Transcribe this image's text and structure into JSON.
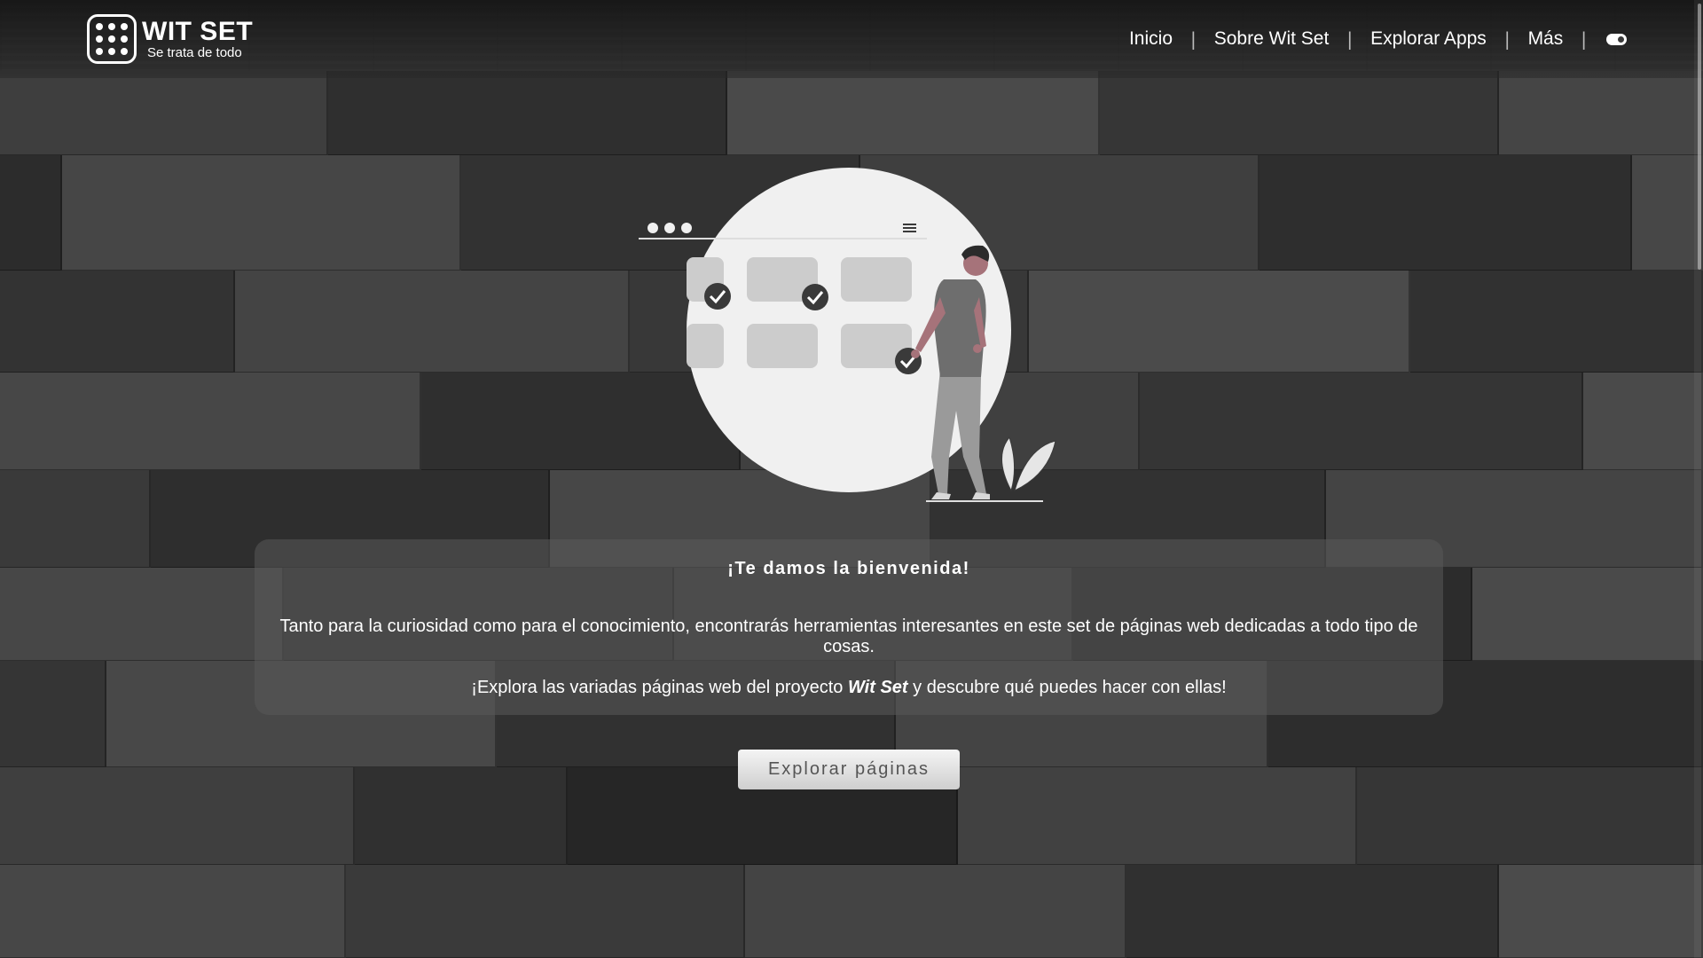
{
  "header": {
    "brand_title": "WIT SET",
    "brand_subtitle": "Se trata de todo",
    "logo_icon": "grid-dots-icon",
    "nav": [
      {
        "label": "Inicio"
      },
      {
        "label": "Sobre Wit Set"
      },
      {
        "label": "Explorar Apps"
      },
      {
        "label": "Más"
      }
    ],
    "separator": "|",
    "theme_toggle_icon": "toggle-icon"
  },
  "welcome": {
    "title": "¡Te damos la bienvenida!",
    "paragraph1": "Tanto para la curiosidad como para el conocimiento, encontrarás herramientas interesantes en este set de páginas web dedicadas a todo tipo de cosas.",
    "paragraph2_before": "¡Explora las variadas páginas web del proyecto",
    "paragraph2_emphasis": "Wit Set",
    "paragraph2_after": "y descubre qué puedes hacer con ellas!"
  },
  "cta": {
    "label": "Explorar páginas"
  },
  "colors": {
    "background": "#3a3a3a",
    "card": "#5a5a5a",
    "text": "#ffffff",
    "button_text": "#555555",
    "illustration_accent": "#a6737a"
  }
}
